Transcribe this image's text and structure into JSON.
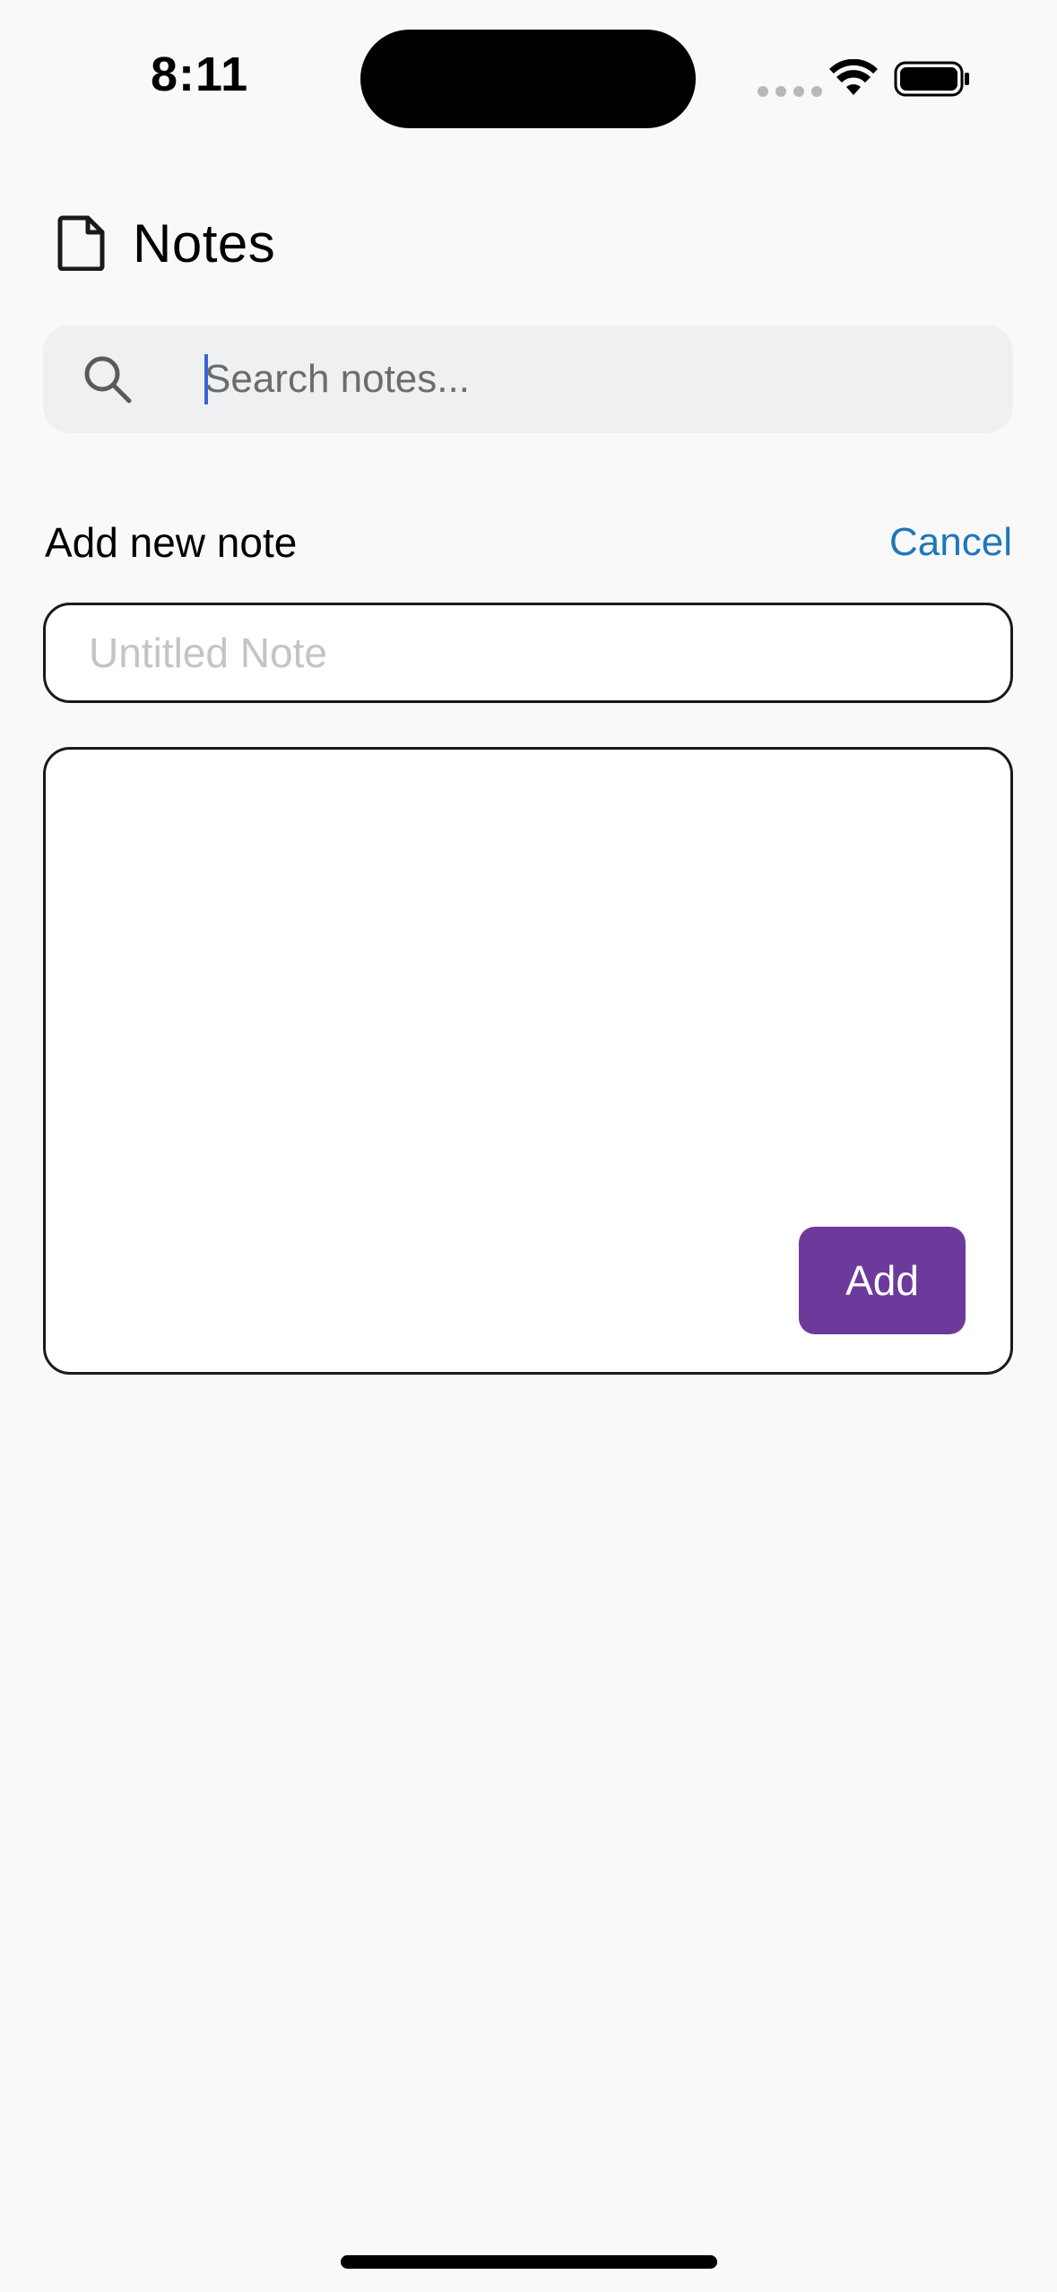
{
  "status_bar": {
    "time": "8:11"
  },
  "header": {
    "title": "Notes",
    "icon": "document-icon"
  },
  "search": {
    "placeholder": "Search notes...",
    "value": "",
    "icon": "search-icon"
  },
  "add_note": {
    "section_title": "Add new note",
    "cancel_label": "Cancel",
    "title_placeholder": "Untitled Note",
    "title_value": "",
    "body_value": "",
    "add_label": "Add"
  },
  "colors": {
    "accent_purple": "#6d3a9c",
    "link_blue": "#1f77b8",
    "search_bg": "#eff0f2",
    "page_bg": "#f9f9f9"
  }
}
